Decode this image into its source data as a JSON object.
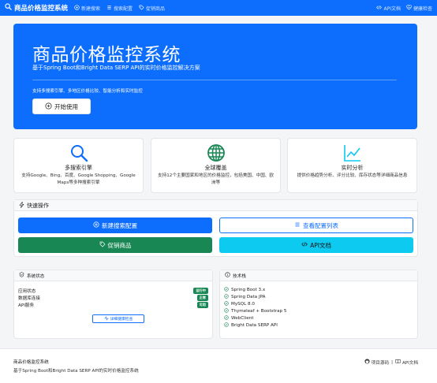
{
  "navbar": {
    "brand": "商品价格监控系统",
    "links": [
      {
        "icon": "plus-circle-icon",
        "label": "新建搜索"
      },
      {
        "icon": "list-icon",
        "label": "搜索配置"
      },
      {
        "icon": "tag-icon",
        "label": "促销商品"
      }
    ],
    "right_links": [
      {
        "icon": "code-icon",
        "label": "API文档"
      },
      {
        "icon": "heart-pulse-icon",
        "label": "健康检查"
      }
    ]
  },
  "hero": {
    "title": "商品价格监控系统",
    "subtitle": "基于Spring Boot和Bright Data SERP API的实时价格监控解决方案",
    "description": "支持多搜索引擎、多地区价格比较、智能分析和实时监控",
    "start_button": "开始使用"
  },
  "features": [
    {
      "icon": "search-icon",
      "title": "多搜索引擎",
      "desc": "支持Google、Bing、百度、Google Shopping、Google Maps等多种搜索引擎"
    },
    {
      "icon": "globe-icon",
      "title": "全球覆盖",
      "desc": "支持12个主要国家和地区的价格监控，包括美国、中国、欧洲等"
    },
    {
      "icon": "chart-line-icon",
      "title": "实时分析",
      "desc": "提供价格趋势分析、评分比较、库存状态等详细商品信息"
    }
  ],
  "quick_actions": {
    "title": "快速操作",
    "new_search": "新建搜索配置",
    "view_list": "查看配置列表",
    "promotions": "促销商品",
    "api_docs": "API文档"
  },
  "system_status": {
    "title": "系统状态",
    "rows": [
      {
        "label": "应用状态",
        "badge": "运行中"
      },
      {
        "label": "数据库连接",
        "badge": "正常"
      },
      {
        "label": "API服务",
        "badge": "可用"
      }
    ],
    "detail_button": "详细健康检查"
  },
  "tech_stack": {
    "title": "技术栈",
    "items": [
      "Spring Boot 3.x",
      "Spring Data JPA",
      "MySQL 8.0",
      "Thymeleaf + Bootstrap 5",
      "WebClient",
      "Bright Data SERP API"
    ]
  },
  "footer": {
    "title": "商品价格监控系统",
    "subtitle": "基于Spring Boot和Bright Data SERP API的实时价格监控系统",
    "source_link": "项目源码",
    "api_link": "API文档",
    "separator": "|"
  },
  "colors": {
    "primary": "#0d6efd",
    "success": "#198754",
    "info": "#0dcaf0"
  }
}
